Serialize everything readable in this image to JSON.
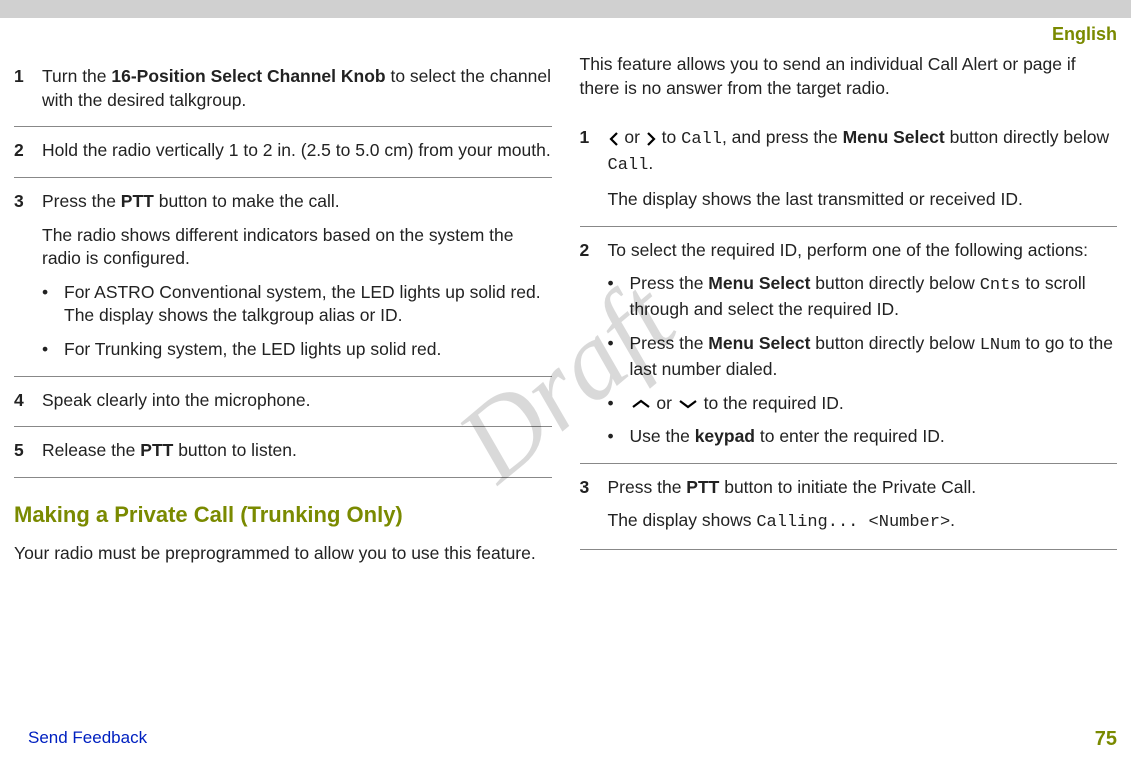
{
  "header": {
    "language": "English"
  },
  "left": {
    "steps": [
      {
        "num": "1",
        "html": "Turn the <span class='b'>16-Position Select Channel Knob</span> to select the channel with the desired talkgroup."
      },
      {
        "num": "2",
        "html": "Hold the radio vertically 1 to 2 in. (2.5 to 5.0 cm) from your mouth."
      },
      {
        "num": "3",
        "html": "Press the <span class='b'>PTT</span> button to make the call.",
        "after": "The radio shows different indicators based on the system the radio is configured.",
        "bullets": [
          "For ASTRO Conventional system, the LED lights up solid red. The display shows the talkgroup alias or ID.",
          "For Trunking system, the LED lights up solid red."
        ]
      },
      {
        "num": "4",
        "html": "Speak clearly into the microphone."
      },
      {
        "num": "5",
        "html": "Release the <span class='b'>PTT</span> button to listen."
      }
    ],
    "heading": "Making a Private Call (Trunking Only)",
    "intro": "Your radio must be preprogrammed to allow you to use this feature."
  },
  "right": {
    "intro": "This feature allows you to send an individual Call Alert or page if there is no answer from the target radio.",
    "steps": [
      {
        "num": "1",
        "html": "<svg class='chev' width='12' height='16' viewBox='0 0 12 16'><path d='M9 2 L3 8 L9 14' fill='none' stroke='#000' stroke-width='2.2'/></svg> or <svg class='chev' width='12' height='16' viewBox='0 0 12 16'><path d='M3 2 L9 8 L3 14' fill='none' stroke='#000' stroke-width='2.2'/></svg> to <span class='mono'>Call</span>, and press the <span class='b'>Menu Select</span> button directly below <span class='mono'>Call</span>.",
        "after": "The display shows the last transmitted or received ID."
      },
      {
        "num": "2",
        "html": "To select the required ID, perform one of the following actions:",
        "bullets_html": [
          "Press the <span class='b'>Menu Select</span> button directly below <span class='mono'>Cnts</span> to scroll through and select the required ID.",
          "Press the <span class='b'>Menu Select</span> button directly below <span class='mono'>LNum</span> to go to the last number dialed.",
          "<svg class='chev' width='22' height='12' viewBox='0 0 22 12'><path d='M3 9 L11 3 L19 9' fill='none' stroke='#000' stroke-width='2.2'/></svg> or <svg class='chev' width='22' height='12' viewBox='0 0 22 12'><path d='M3 3 L11 9 L19 3' fill='none' stroke='#000' stroke-width='2.2'/></svg> to the required ID.",
          "Use the <span class='b'>keypad</span> to enter the required ID."
        ]
      },
      {
        "num": "3",
        "html": "Press the <span class='b'>PTT</span> button to initiate the Private Call.",
        "after_html": "The display shows <span class='mono'>Calling... &lt;Number&gt;</span>."
      }
    ]
  },
  "footer": {
    "feedback": "Send Feedback",
    "page": "75"
  },
  "watermark": "Draft"
}
